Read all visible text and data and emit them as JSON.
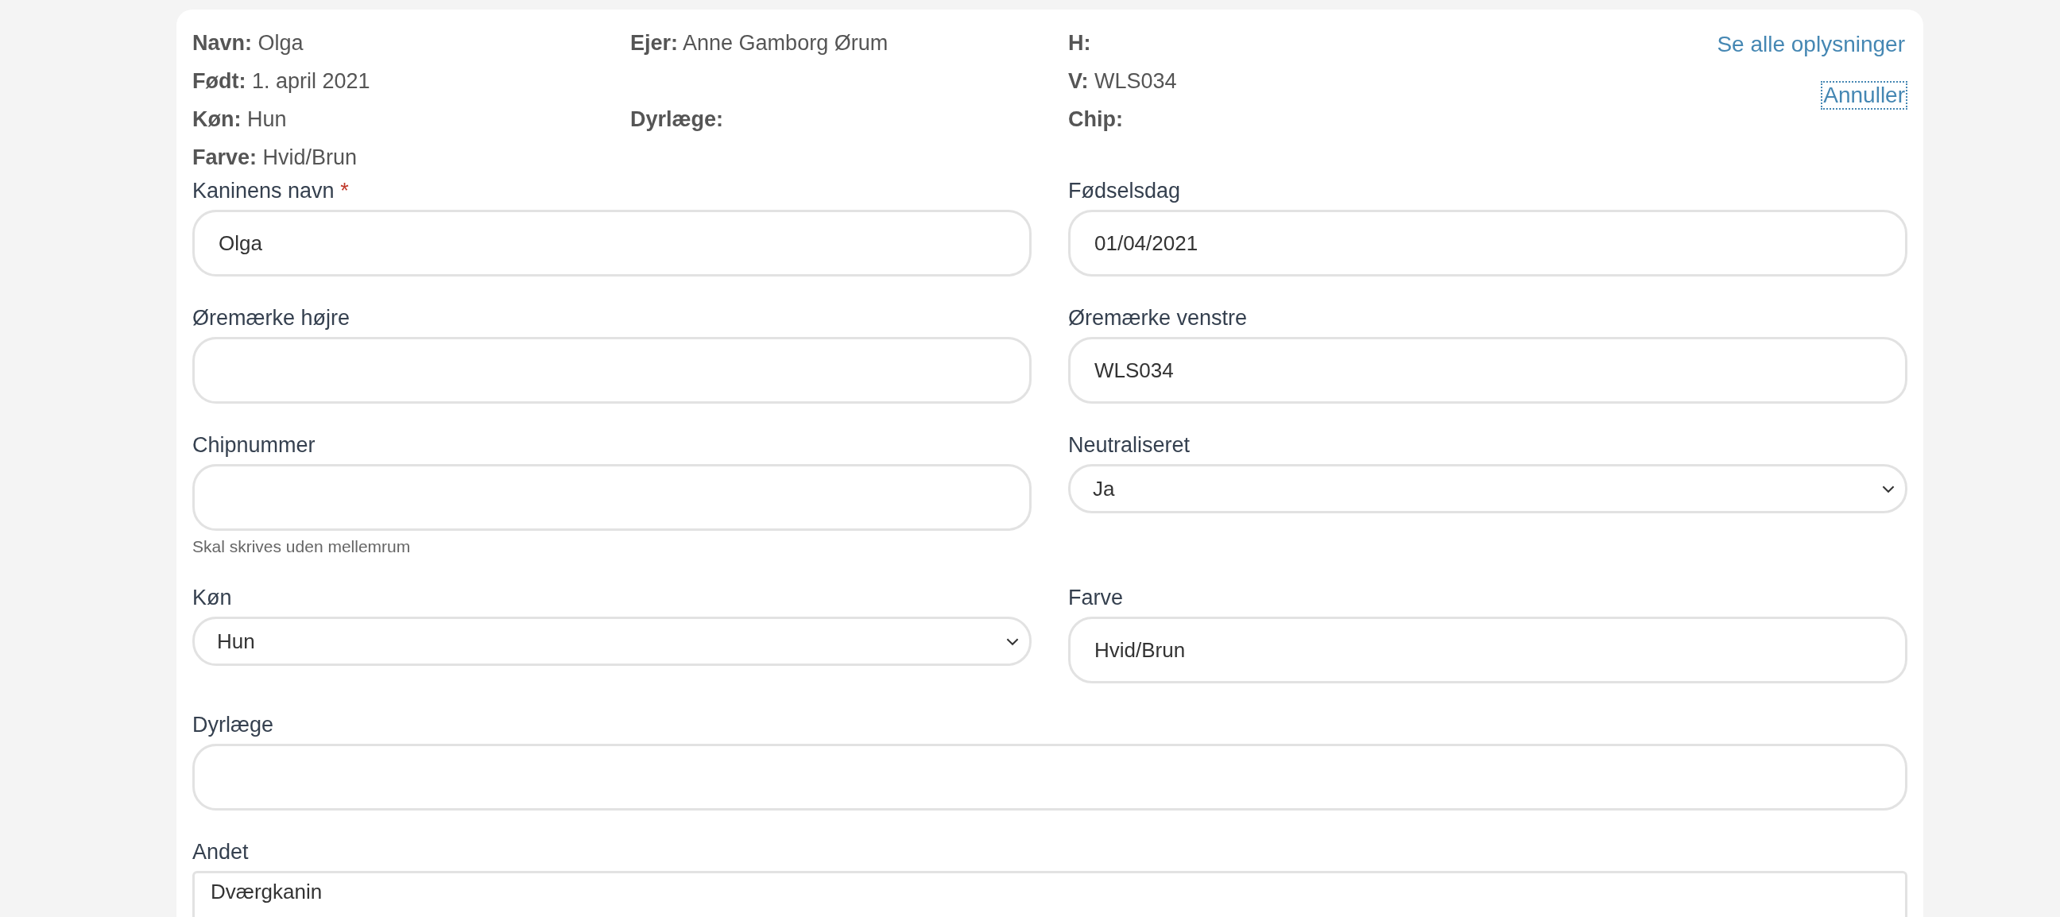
{
  "info": {
    "rows": [
      [
        {
          "label": "Navn:",
          "value": "Olga"
        },
        {
          "label": "Ejer:",
          "value": "Anne Gamborg Ørum"
        },
        {
          "label": "H:"
        }
      ],
      [
        {
          "label": "Født:",
          "value": "1. april 2021"
        },
        null,
        {
          "label": "V:",
          "value": "WLS034"
        }
      ],
      [
        {
          "label": "Køn:",
          "value": "Hun"
        },
        {
          "label": "Dyrlæge:"
        },
        {
          "label": "Chip:"
        }
      ],
      [
        {
          "label": "Farve:",
          "value": "Hvid/Brun"
        },
        null,
        null
      ]
    ],
    "links": [
      {
        "text": "Se alle oplysninger",
        "focused": false
      },
      {
        "text": "Annuller",
        "focused": true
      }
    ]
  },
  "fields": [
    {
      "kind": "input",
      "label": "Kaninens navn",
      "required_mark": "*",
      "value": "Olga",
      "wide": false
    },
    {
      "kind": "input",
      "label": "Fødselsdag",
      "value": "01/04/2021",
      "wide": false
    },
    {
      "kind": "input",
      "label": "Øremærke højre",
      "wide": false
    },
    {
      "kind": "input",
      "label": "Øremærke venstre",
      "value": "WLS034",
      "wide": false
    },
    {
      "kind": "input",
      "label": "Chipnummer",
      "hint": "Skal skrives uden mellemrum",
      "wide": false
    },
    {
      "kind": "select",
      "label": "Neutraliseret",
      "value": "Ja",
      "wide": false
    },
    {
      "kind": "select",
      "label": "Køn",
      "value": "Hun",
      "wide": false
    },
    {
      "kind": "input",
      "label": "Farve",
      "value": "Hvid/Brun",
      "wide": false
    },
    {
      "kind": "input",
      "label": "Dyrlæge",
      "wide": true
    },
    {
      "kind": "textarea",
      "label": "Andet",
      "value": "Dværgkanin",
      "wide": true
    }
  ]
}
